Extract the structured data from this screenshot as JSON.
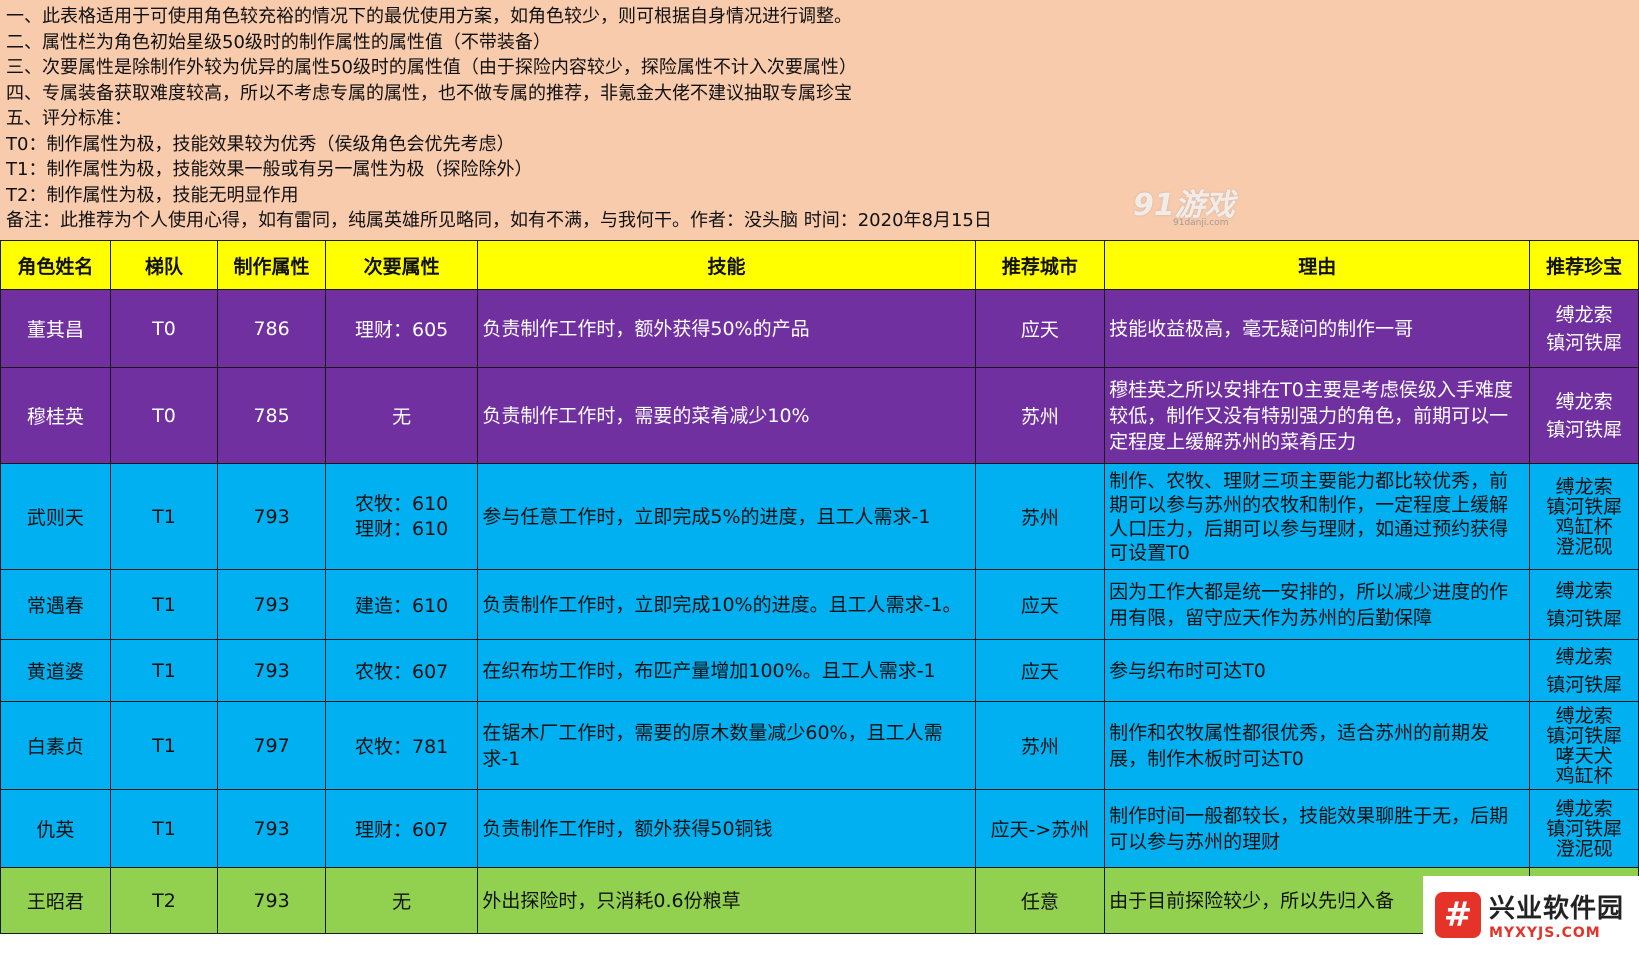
{
  "notes": [
    "一、此表格适用于可使用角色较充裕的情况下的最优使用方案，如角色较少，则可根据自身情况进行调整。",
    "二、属性栏为角色初始星级50级时的制作属性的属性值（不带装备）",
    "三、次要属性是除制作外较为优异的属性50级时的属性值（由于探险内容较少，探险属性不计入次要属性）",
    "四、专属装备获取难度较高，所以不考虑专属的属性，也不做专属的推荐，非氪金大佬不建议抽取专属珍宝",
    "五、评分标准：",
    "T0：制作属性为极，技能效果较为优秀（侯级角色会优先考虑）",
    "T1：制作属性为极，技能效果一般或有另一属性为极（探险除外）",
    "T2：制作属性为极，技能无明显作用",
    "备注：此推荐为个人使用心得，如有雷同，纯属英雄所见略同，如有不满，与我何干。作者：没头脑  时间：2020年8月15日"
  ],
  "watermark": {
    "main": "91游戏",
    "sub": "91danji.com"
  },
  "headers": [
    "角色姓名",
    "梯队",
    "制作属性",
    "次要属性",
    "技能",
    "推荐城市",
    "理由",
    "推荐珍宝"
  ],
  "rows": [
    {
      "name": "董其昌",
      "tier": "T0",
      "craft": "786",
      "secondary": [
        "理财：605"
      ],
      "skill": "负责制作工作时，额外获得50%的产品",
      "city": "应天",
      "reason": "技能收益极高，毫无疑问的制作一哥",
      "treasures": [
        "缚龙索",
        "镇河铁犀"
      ],
      "color": "purple"
    },
    {
      "name": "穆桂英",
      "tier": "T0",
      "craft": "785",
      "secondary": [
        "无"
      ],
      "skill": "负责制作工作时，需要的菜肴减少10%",
      "city": "苏州",
      "reason": "穆桂英之所以安排在T0主要是考虑侯级入手难度较低，制作又没有特别强力的角色，前期可以一定程度上缓解苏州的菜肴压力",
      "treasures": [
        "缚龙索",
        "镇河铁犀"
      ],
      "color": "purple"
    },
    {
      "name": "武则天",
      "tier": "T1",
      "craft": "793",
      "secondary": [
        "农牧：610",
        "理财：610"
      ],
      "skill": "参与任意工作时，立即完成5%的进度，且工人需求-1",
      "city": "苏州",
      "reason": "制作、农牧、理财三项主要能力都比较优秀，前期可以参与苏州的农牧和制作，一定程度上缓解人口压力，后期可以参与理财，如通过预约获得可设置T0",
      "treasures": [
        "缚龙索",
        "镇河铁犀",
        "鸡缸杯",
        "澄泥砚"
      ],
      "color": "blue"
    },
    {
      "name": "常遇春",
      "tier": "T1",
      "craft": "793",
      "secondary": [
        "建造：610"
      ],
      "skill": "负责制作工作时，立即完成10%的进度。且工人需求-1。",
      "city": "应天",
      "reason": "因为工作大都是统一安排的，所以减少进度的作用有限，留守应天作为苏州的后勤保障",
      "treasures": [
        "缚龙索",
        "镇河铁犀"
      ],
      "color": "blue"
    },
    {
      "name": "黄道婆",
      "tier": "T1",
      "craft": "793",
      "secondary": [
        "农牧：607"
      ],
      "skill": "在织布坊工作时，布匹产量增加100%。且工人需求-1",
      "city": "应天",
      "reason": "参与织布时可达T0",
      "treasures": [
        "缚龙索",
        "镇河铁犀"
      ],
      "color": "blue"
    },
    {
      "name": "白素贞",
      "tier": "T1",
      "craft": "797",
      "secondary": [
        "农牧：781"
      ],
      "skill": "在锯木厂工作时，需要的原木数量减少60%，且工人需求-1",
      "city": "苏州",
      "reason": "制作和农牧属性都很优秀，适合苏州的前期发展，制作木板时可达T0",
      "treasures": [
        "缚龙索",
        "镇河铁犀",
        "哮天犬",
        "鸡缸杯"
      ],
      "color": "blue"
    },
    {
      "name": "仇英",
      "tier": "T1",
      "craft": "793",
      "secondary": [
        "理财：607"
      ],
      "skill": "负责制作工作时，额外获得50铜钱",
      "city": "应天->苏州",
      "reason": "制作时间一般都较长，技能效果聊胜于无，后期可以参与苏州的理财",
      "treasures": [
        "缚龙索",
        "镇河铁犀",
        "澄泥砚"
      ],
      "color": "blue"
    },
    {
      "name": "王昭君",
      "tier": "T2",
      "craft": "793",
      "secondary": [
        "无"
      ],
      "skill": "外出探险时，只消耗0.6份粮草",
      "city": "任意",
      "reason": "由于目前探险较少，所以先归入备",
      "treasures": [],
      "color": "green"
    }
  ],
  "logo": {
    "mark": "#",
    "name": "兴业软件园",
    "url": "MYXYJS.COM"
  }
}
